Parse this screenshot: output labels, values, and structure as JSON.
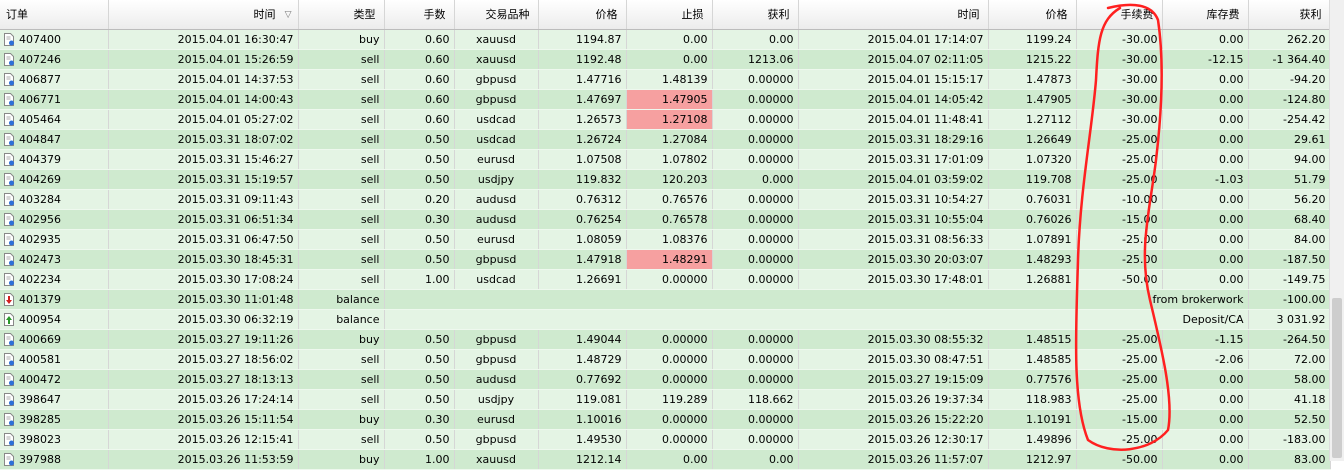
{
  "columns": [
    "订单",
    "时间",
    "类型",
    "手数",
    "交易品种",
    "价格",
    "止损",
    "获利",
    "时间",
    "价格",
    "手续费",
    "库存费",
    "获利"
  ],
  "rows": [
    {
      "order": "407400",
      "time": "2015.04.01 16:30:47",
      "type": "buy",
      "lots": "0.60",
      "symbol": "xauusd",
      "price": "1194.87",
      "sl": "0.00",
      "tp": "0.00",
      "close_time": "2015.04.01 17:14:07",
      "close_price": "1199.24",
      "commission": "-30.00",
      "swap": "0.00",
      "profit": "262.20"
    },
    {
      "order": "407246",
      "time": "2015.04.01 15:26:59",
      "type": "sell",
      "lots": "0.60",
      "symbol": "xauusd",
      "price": "1192.48",
      "sl": "0.00",
      "tp": "1213.06",
      "close_time": "2015.04.07 02:11:05",
      "close_price": "1215.22",
      "commission": "-30.00",
      "swap": "-12.15",
      "profit": "-1 364.40"
    },
    {
      "order": "406877",
      "time": "2015.04.01 14:37:53",
      "type": "sell",
      "lots": "0.60",
      "symbol": "gbpusd",
      "price": "1.47716",
      "sl": "1.48139",
      "tp": "0.00000",
      "close_time": "2015.04.01 15:15:17",
      "close_price": "1.47873",
      "commission": "-30.00",
      "swap": "0.00",
      "profit": "-94.20"
    },
    {
      "order": "406771",
      "time": "2015.04.01 14:00:43",
      "type": "sell",
      "lots": "0.60",
      "symbol": "gbpusd",
      "price": "1.47697",
      "sl": "1.47905",
      "tp": "0.00000",
      "close_time": "2015.04.01 14:05:42",
      "close_price": "1.47905",
      "commission": "-30.00",
      "swap": "0.00",
      "profit": "-124.80",
      "sl_hit": true
    },
    {
      "order": "405464",
      "time": "2015.04.01 05:27:02",
      "type": "sell",
      "lots": "0.60",
      "symbol": "usdcad",
      "price": "1.26573",
      "sl": "1.27108",
      "tp": "0.00000",
      "close_time": "2015.04.01 11:48:41",
      "close_price": "1.27112",
      "commission": "-30.00",
      "swap": "0.00",
      "profit": "-254.42",
      "sl_hit": true
    },
    {
      "order": "404847",
      "time": "2015.03.31 18:07:02",
      "type": "sell",
      "lots": "0.50",
      "symbol": "usdcad",
      "price": "1.26724",
      "sl": "1.27084",
      "tp": "0.00000",
      "close_time": "2015.03.31 18:29:16",
      "close_price": "1.26649",
      "commission": "-25.00",
      "swap": "0.00",
      "profit": "29.61"
    },
    {
      "order": "404379",
      "time": "2015.03.31 15:46:27",
      "type": "sell",
      "lots": "0.50",
      "symbol": "eurusd",
      "price": "1.07508",
      "sl": "1.07802",
      "tp": "0.00000",
      "close_time": "2015.03.31 17:01:09",
      "close_price": "1.07320",
      "commission": "-25.00",
      "swap": "0.00",
      "profit": "94.00"
    },
    {
      "order": "404269",
      "time": "2015.03.31 15:19:57",
      "type": "sell",
      "lots": "0.50",
      "symbol": "usdjpy",
      "price": "119.832",
      "sl": "120.203",
      "tp": "0.000",
      "close_time": "2015.04.01 03:59:02",
      "close_price": "119.708",
      "commission": "-25.00",
      "swap": "-1.03",
      "profit": "51.79"
    },
    {
      "order": "403284",
      "time": "2015.03.31 09:11:43",
      "type": "sell",
      "lots": "0.20",
      "symbol": "audusd",
      "price": "0.76312",
      "sl": "0.76576",
      "tp": "0.00000",
      "close_time": "2015.03.31 10:54:27",
      "close_price": "0.76031",
      "commission": "-10.00",
      "swap": "0.00",
      "profit": "56.20"
    },
    {
      "order": "402956",
      "time": "2015.03.31 06:51:34",
      "type": "sell",
      "lots": "0.30",
      "symbol": "audusd",
      "price": "0.76254",
      "sl": "0.76578",
      "tp": "0.00000",
      "close_time": "2015.03.31 10:55:04",
      "close_price": "0.76026",
      "commission": "-15.00",
      "swap": "0.00",
      "profit": "68.40"
    },
    {
      "order": "402935",
      "time": "2015.03.31 06:47:50",
      "type": "sell",
      "lots": "0.50",
      "symbol": "eurusd",
      "price": "1.08059",
      "sl": "1.08376",
      "tp": "0.00000",
      "close_time": "2015.03.31 08:56:33",
      "close_price": "1.07891",
      "commission": "-25.00",
      "swap": "0.00",
      "profit": "84.00"
    },
    {
      "order": "402473",
      "time": "2015.03.30 18:45:31",
      "type": "sell",
      "lots": "0.50",
      "symbol": "gbpusd",
      "price": "1.47918",
      "sl": "1.48291",
      "tp": "0.00000",
      "close_time": "2015.03.30 20:03:07",
      "close_price": "1.48293",
      "commission": "-25.00",
      "swap": "0.00",
      "profit": "-187.50",
      "sl_hit": true
    },
    {
      "order": "402234",
      "time": "2015.03.30 17:08:24",
      "type": "sell",
      "lots": "1.00",
      "symbol": "usdcad",
      "price": "1.26691",
      "sl": "0.00000",
      "tp": "0.00000",
      "close_time": "2015.03.30 17:48:01",
      "close_price": "1.26881",
      "commission": "-50.00",
      "swap": "0.00",
      "profit": "-149.75"
    },
    {
      "order": "401379",
      "time": "2015.03.30 11:01:48",
      "type": "balance",
      "comment": "from brokerwork",
      "profit": "-100.00",
      "balance": true,
      "icon": "withdrawal-icon"
    },
    {
      "order": "400954",
      "time": "2015.03.30 06:32:19",
      "type": "balance",
      "comment": "Deposit/CA",
      "profit": "3 031.92",
      "balance": true,
      "icon": "deposit-icon"
    },
    {
      "order": "400669",
      "time": "2015.03.27 19:11:26",
      "type": "buy",
      "lots": "0.50",
      "symbol": "gbpusd",
      "price": "1.49044",
      "sl": "0.00000",
      "tp": "0.00000",
      "close_time": "2015.03.30 08:55:32",
      "close_price": "1.48515",
      "commission": "-25.00",
      "swap": "-1.15",
      "profit": "-264.50"
    },
    {
      "order": "400581",
      "time": "2015.03.27 18:56:02",
      "type": "sell",
      "lots": "0.50",
      "symbol": "gbpusd",
      "price": "1.48729",
      "sl": "0.00000",
      "tp": "0.00000",
      "close_time": "2015.03.30 08:47:51",
      "close_price": "1.48585",
      "commission": "-25.00",
      "swap": "-2.06",
      "profit": "72.00"
    },
    {
      "order": "400472",
      "time": "2015.03.27 18:13:13",
      "type": "sell",
      "lots": "0.50",
      "symbol": "audusd",
      "price": "0.77692",
      "sl": "0.00000",
      "tp": "0.00000",
      "close_time": "2015.03.27 19:15:09",
      "close_price": "0.77576",
      "commission": "-25.00",
      "swap": "0.00",
      "profit": "58.00"
    },
    {
      "order": "398647",
      "time": "2015.03.26 17:24:14",
      "type": "sell",
      "lots": "0.50",
      "symbol": "usdjpy",
      "price": "119.081",
      "sl": "119.289",
      "tp": "118.662",
      "close_time": "2015.03.26 19:37:34",
      "close_price": "118.983",
      "commission": "-25.00",
      "swap": "0.00",
      "profit": "41.18"
    },
    {
      "order": "398285",
      "time": "2015.03.26 15:11:54",
      "type": "buy",
      "lots": "0.30",
      "symbol": "eurusd",
      "price": "1.10016",
      "sl": "0.00000",
      "tp": "0.00000",
      "close_time": "2015.03.26 15:22:20",
      "close_price": "1.10191",
      "commission": "-15.00",
      "swap": "0.00",
      "profit": "52.50"
    },
    {
      "order": "398023",
      "time": "2015.03.26 12:15:41",
      "type": "sell",
      "lots": "0.50",
      "symbol": "gbpusd",
      "price": "1.49530",
      "sl": "0.00000",
      "tp": "0.00000",
      "close_time": "2015.03.26 12:30:17",
      "close_price": "1.49896",
      "commission": "-25.00",
      "swap": "0.00",
      "profit": "-183.00"
    },
    {
      "order": "397988",
      "time": "2015.03.26 11:53:59",
      "type": "buy",
      "lots": "1.00",
      "symbol": "xauusd",
      "price": "1212.14",
      "sl": "0.00",
      "tp": "0.00",
      "close_time": "2015.03.26 11:57:07",
      "close_price": "1212.97",
      "commission": "-50.00",
      "swap": "0.00",
      "profit": "83.00"
    }
  ],
  "colors": {
    "row_light": "#e4f4e4",
    "row_dark": "#cfeacf",
    "stop_loss_hit": "#f6a0a0",
    "annotation": "#ff2020"
  },
  "icons": {
    "sort": "sort-descending-icon",
    "trade": "trade-document-icon",
    "deposit": "deposit-icon",
    "withdrawal": "withdrawal-icon"
  },
  "header_sort_glyph": "▽"
}
